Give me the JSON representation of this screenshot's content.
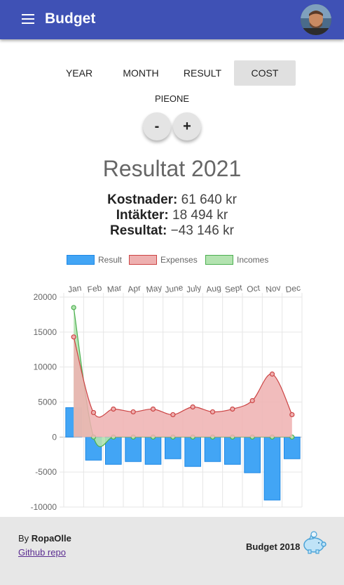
{
  "app": {
    "title": "Budget"
  },
  "tabs": [
    {
      "label": "YEAR",
      "active": false
    },
    {
      "label": "MONTH",
      "active": false
    },
    {
      "label": "RESULT",
      "active": false
    },
    {
      "label": "COST",
      "active": true
    }
  ],
  "pie_label": "PIEONE",
  "buttons": {
    "minus": "-",
    "plus": "+"
  },
  "heading": "Resultat 2021",
  "stats": {
    "costs_label": "Kostnader:",
    "costs_value": "61 640 kr",
    "incomes_label": "Intäkter:",
    "incomes_value": "18 494 kr",
    "result_label": "Resultat:",
    "result_value": "−43 146 kr"
  },
  "legend": [
    {
      "name": "Result",
      "fill": "#42a5f5",
      "stroke": "#1e88e5"
    },
    {
      "name": "Expenses",
      "fill": "#eeb0b0",
      "stroke": "#cc4444"
    },
    {
      "name": "Incomes",
      "fill": "#b3e3b0",
      "stroke": "#4caf50"
    }
  ],
  "chart_data": {
    "type": "bar",
    "categories": [
      "Jan",
      "Feb",
      "Mar",
      "Apr",
      "May",
      "June",
      "July",
      "Aug",
      "Sept",
      "Oct",
      "Nov",
      "Dec"
    ],
    "series": [
      {
        "name": "Result",
        "type": "bar",
        "values": [
          4200,
          -3300,
          -3900,
          -3500,
          -3900,
          -3100,
          -4200,
          -3500,
          -3900,
          -5100,
          -9000,
          -3100
        ]
      },
      {
        "name": "Expenses",
        "type": "area",
        "values": [
          14300,
          3500,
          4000,
          3600,
          4000,
          3200,
          4300,
          3600,
          4000,
          5200,
          9000,
          3200
        ]
      },
      {
        "name": "Incomes",
        "type": "area",
        "values": [
          18500,
          0,
          0,
          0,
          0,
          0,
          0,
          0,
          0,
          0,
          0,
          0
        ]
      }
    ],
    "ylim": [
      -10000,
      20000
    ],
    "yticks": [
      20000,
      15000,
      10000,
      5000,
      0,
      -5000,
      -10000
    ],
    "grid": true,
    "legend_position": "top"
  },
  "footer": {
    "by_prefix": "By",
    "author": "RopaOlle",
    "repo_link": "Github repo",
    "app_label": "Budget 2018"
  }
}
